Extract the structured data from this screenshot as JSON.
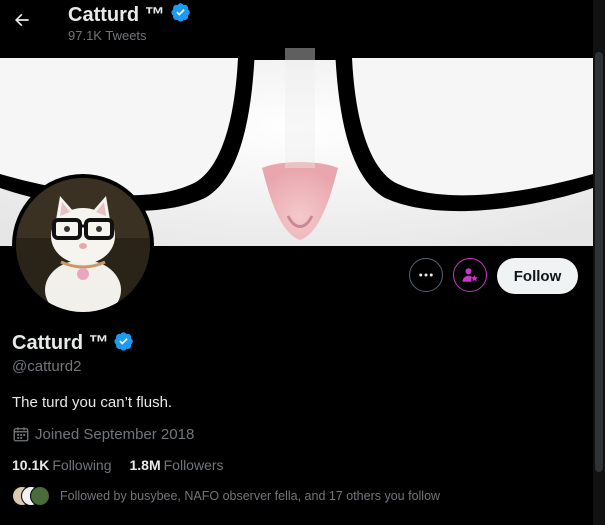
{
  "header": {
    "title": "Catturd ™",
    "tweet_count": "97.1K Tweets"
  },
  "actions": {
    "more_icon": "more-icon",
    "subscribe_icon": "person-star-icon",
    "follow_label": "Follow"
  },
  "profile": {
    "name": "Catturd ™",
    "handle": "@catturd2",
    "bio": "The turd you can’t flush.",
    "joined": "Joined September 2018",
    "following_count": "10.1K",
    "following_label": "Following",
    "followers_count": "1.8M",
    "followers_label": "Followers",
    "followed_by": "Followed by busybee, NAFO observer fella, and 17 others you follow"
  },
  "colors": {
    "verified": "#1d9bf0",
    "subscribe_accent": "#c936c9",
    "background": "#000000"
  }
}
